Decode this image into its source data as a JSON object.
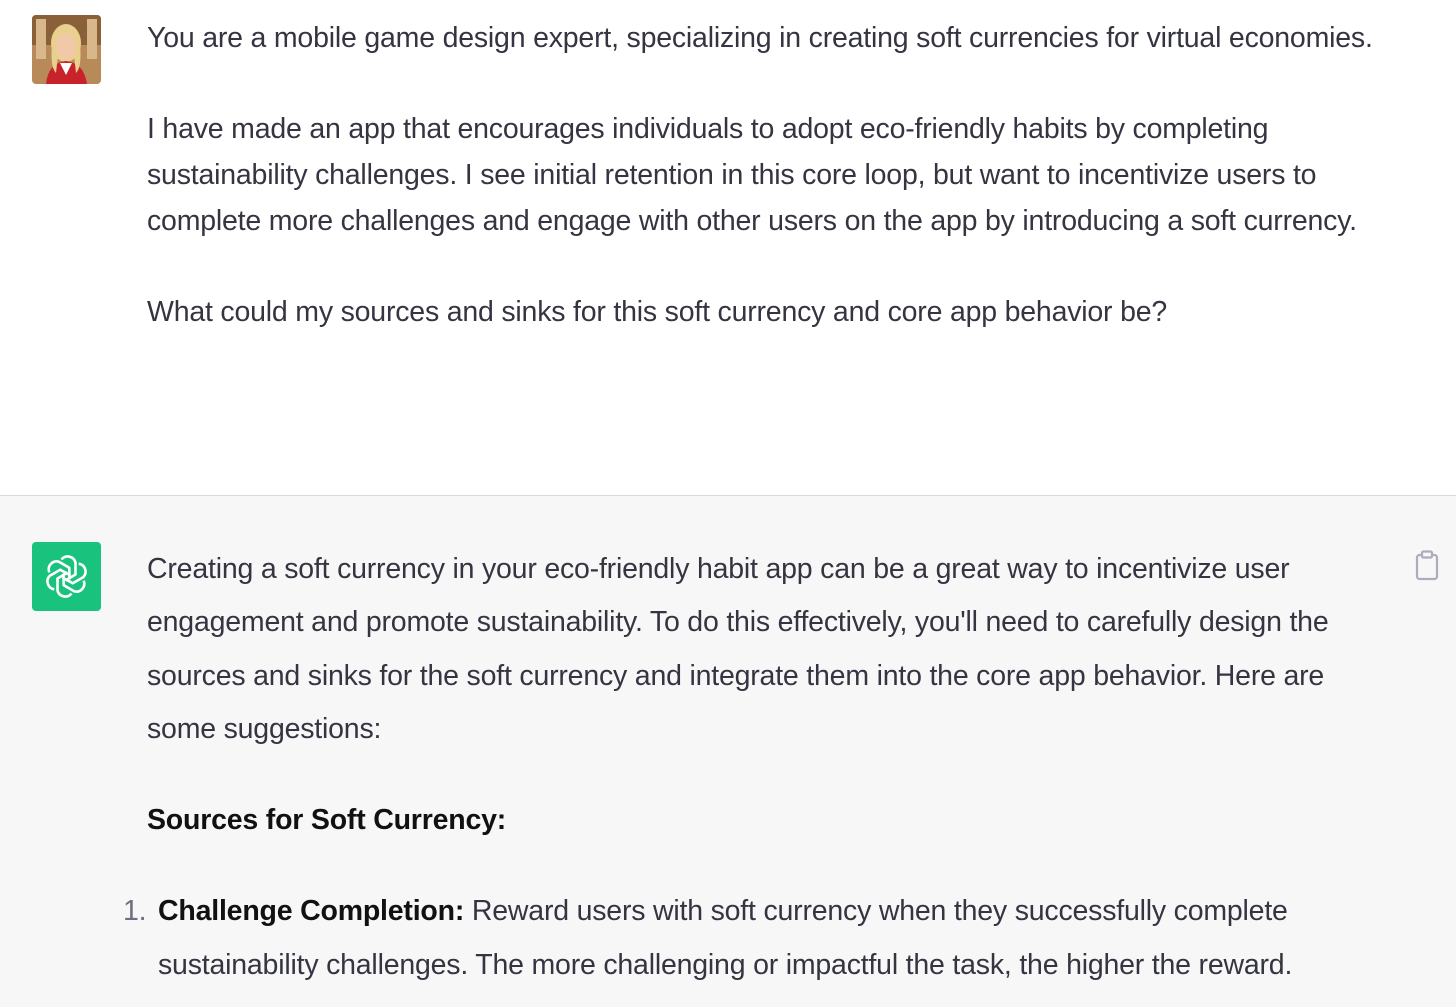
{
  "user": {
    "paragraphs": [
      "You are a mobile game design expert, specializing in creating soft currencies for virtual economies.",
      "I have made an app that encourages individuals to adopt eco-friendly habits by completing sustainability challenges. I see initial retention in this core loop, but want to incentivize users to complete more challenges and engage with other users on the app by introducing a soft currency.",
      "What could my sources and sinks for this soft currency and core app behavior be?"
    ]
  },
  "assistant": {
    "intro": "Creating a soft currency in your eco-friendly habit app can be a great way to incentivize user engagement and promote sustainability. To do this effectively, you'll need to carefully design the sources and sinks for the soft currency and integrate them into the core app behavior. Here are some suggestions:",
    "heading": "Sources for Soft Currency:",
    "list": [
      {
        "number": "1.",
        "lead": "Challenge Completion:",
        "text": " Reward users with soft currency when they successfully complete sustainability challenges. The more challenging or impactful the task, the higher the reward."
      }
    ]
  },
  "colors": {
    "bot_avatar": "#19c37d",
    "assistant_bg": "#f7f7f8",
    "text": "#343541"
  },
  "icons": {
    "bot_avatar": "openai-logo-icon",
    "copy": "clipboard-icon"
  }
}
